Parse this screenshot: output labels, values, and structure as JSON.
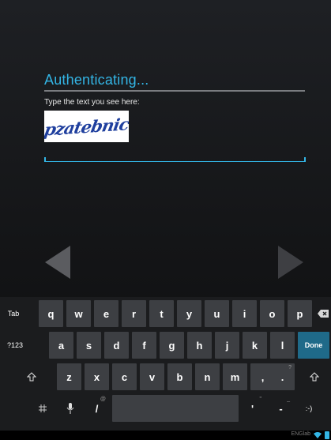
{
  "dialog": {
    "title": "Authenticating...",
    "prompt": "Type the text you see here:",
    "captcha_text": "pzatebnic",
    "answer_value": ""
  },
  "navigation": {
    "back_icon": "chevron-left-icon",
    "next_icon": "chevron-right-icon"
  },
  "keyboard": {
    "row1": {
      "tab": "Tab",
      "letters": [
        "q",
        "w",
        "e",
        "r",
        "t",
        "y",
        "u",
        "i",
        "o",
        "p"
      ],
      "backspace_icon": "backspace-icon"
    },
    "row2": {
      "symbols": "?123",
      "letters": [
        "a",
        "s",
        "d",
        "f",
        "g",
        "h",
        "j",
        "k",
        "l"
      ],
      "done": "Done"
    },
    "row3": {
      "shift_icon": "shift-icon",
      "letters": [
        "z",
        "x",
        "c",
        "v",
        "b",
        "n",
        "m"
      ],
      "comma": ",",
      "comma_alt": "!",
      "period": ".",
      "period_alt": "?"
    },
    "row4": {
      "settings_icon": "keyboard-settings-icon",
      "mic_icon": "microphone-icon",
      "slash": "/",
      "slash_alt": "@",
      "apostrophe": "'",
      "apostrophe_alt": "\"",
      "dash": "-",
      "dash_alt": "_",
      "smiley": ":-)"
    }
  },
  "statusbar": {
    "network_name": "ENGlab",
    "wifi_icon": "wifi-icon",
    "battery_icon": "battery-icon"
  },
  "colors": {
    "accent": "#33b5e5",
    "key": "#3d3f43",
    "done_key": "#1f6a89"
  }
}
